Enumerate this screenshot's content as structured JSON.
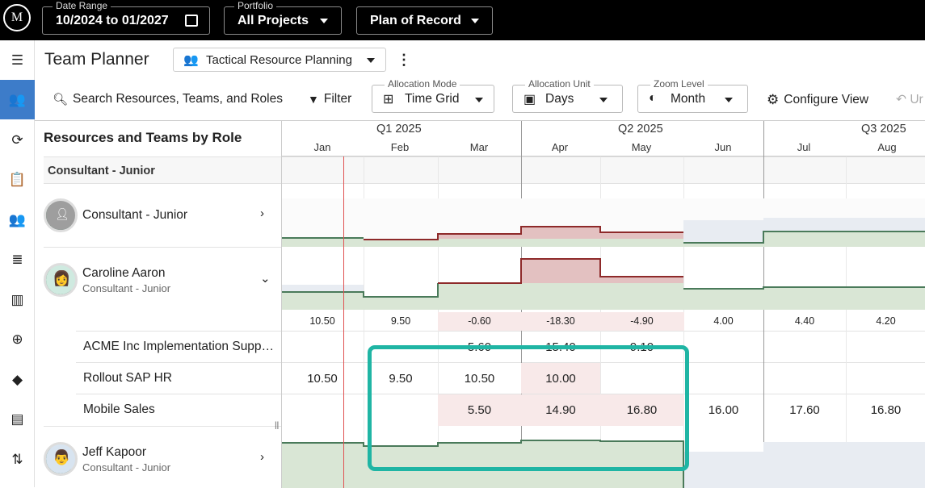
{
  "topbar": {
    "logo": "M",
    "date_range": {
      "legend": "Date Range",
      "value": "10/2024 to 01/2027"
    },
    "portfolio": {
      "legend": "Portfolio",
      "value": "All Projects"
    },
    "plan": {
      "value": "Plan of Record"
    }
  },
  "nav": [
    "menu-icon",
    "resource-planner-icon",
    "refresh-icon",
    "clipboard-icon",
    "people-icon",
    "list-icon",
    "columns-icon",
    "target-icon",
    "direction-icon",
    "document-icon",
    "sort-icon"
  ],
  "header": {
    "title": "Team Planner",
    "view": "Tactical Resource Planning"
  },
  "toolbar": {
    "search": "Search Resources, Teams, and Roles",
    "filter": "Filter",
    "allocation_mode": {
      "legend": "Allocation Mode",
      "value": "Time Grid"
    },
    "allocation_unit": {
      "legend": "Allocation Unit",
      "value": "Days"
    },
    "zoom_level": {
      "legend": "Zoom Level",
      "value": "Month"
    },
    "configure": "Configure View",
    "undo": "Ur"
  },
  "grid": {
    "left_title": "Resources and Teams by Role",
    "section": "Consultant - Junior",
    "quarters": [
      "Q1 2025",
      "Q2 2025",
      "Q3 2025"
    ],
    "months": [
      "Jan",
      "Feb",
      "Mar",
      "Apr",
      "May",
      "Jun",
      "Jul",
      "Aug"
    ],
    "role_row": {
      "name": "Consultant - Junior"
    },
    "person1": {
      "name": "Caroline Aaron",
      "role": "Consultant - Junior"
    },
    "person2": {
      "name": "Jeff Kapoor",
      "role": "Consultant - Junior"
    },
    "remaining": [
      "10.50",
      "9.50",
      "-0.60",
      "-18.30",
      "-4.90",
      "4.00",
      "4.40",
      "4.20"
    ],
    "projects": [
      {
        "name": "ACME Inc Implementation Supp…",
        "values": [
          "",
          "",
          "5.60",
          "15.40",
          "9.10",
          "",
          "",
          ""
        ]
      },
      {
        "name": "Rollout SAP HR",
        "values": [
          "10.50",
          "9.50",
          "10.50",
          "10.00",
          "",
          "",
          "",
          ""
        ]
      },
      {
        "name": "Mobile Sales",
        "values": [
          "",
          "",
          "5.50",
          "14.90",
          "16.80",
          "16.00",
          "17.60",
          "16.80"
        ]
      }
    ]
  }
}
